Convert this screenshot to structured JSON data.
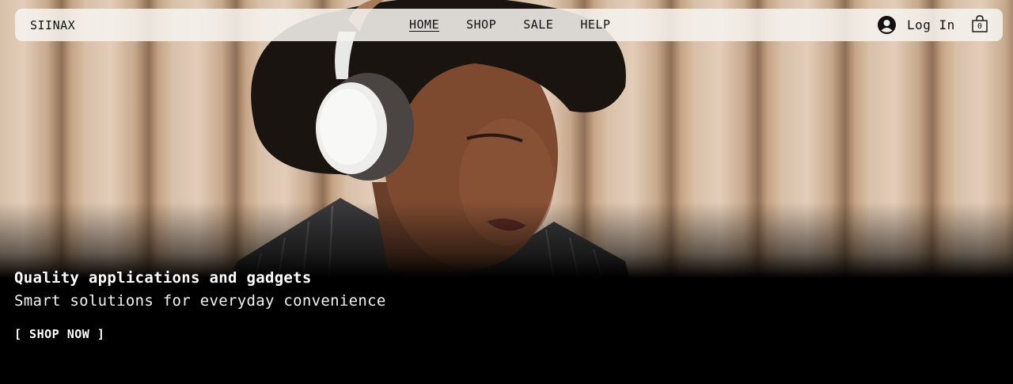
{
  "brand": {
    "name": "SIINAX"
  },
  "nav": {
    "items": [
      {
        "label": "HOME",
        "active": true
      },
      {
        "label": "SHOP",
        "active": false
      },
      {
        "label": "SALE",
        "active": false
      },
      {
        "label": "HELP",
        "active": false
      }
    ]
  },
  "account": {
    "login_label": "Log In",
    "icon": "user-avatar-icon"
  },
  "cart": {
    "count": "0",
    "icon": "shopping-bag-icon"
  },
  "hero": {
    "title": "Quality applications and gadgets",
    "subtitle": "Smart solutions for everyday convenience",
    "cta_label": "[ SHOP NOW ]",
    "image": "woman-with-headphones-photo"
  }
}
